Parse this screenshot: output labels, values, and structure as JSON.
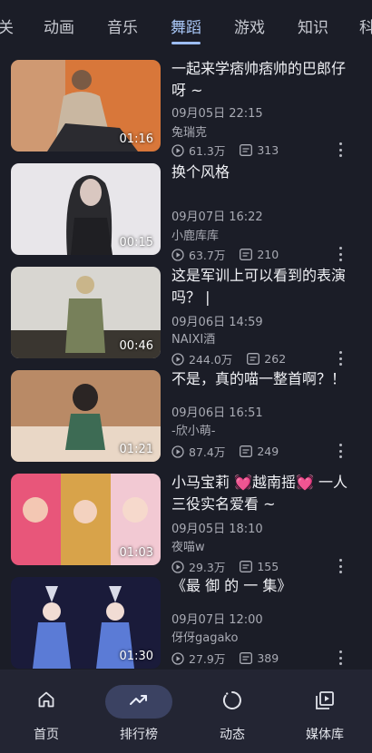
{
  "tabs": [
    {
      "label": "关",
      "active": false
    },
    {
      "label": "动画",
      "active": false
    },
    {
      "label": "音乐",
      "active": false
    },
    {
      "label": "舞蹈",
      "active": true
    },
    {
      "label": "游戏",
      "active": false
    },
    {
      "label": "知识",
      "active": false
    },
    {
      "label": "科",
      "active": false
    }
  ],
  "videos": [
    {
      "title": "一起来学痞帅痞帅的巴郎仔呀 ~",
      "date": "09月05日 22:15",
      "author": "兔瑞克",
      "views": "61.3万",
      "danmaku": "313",
      "duration": "01:16",
      "thumb_colors": [
        "#d8773a",
        "#c9b7a1",
        "#7a5a44"
      ]
    },
    {
      "title": "换个风格",
      "date": "09月07日 16:22",
      "author": "小鹿库库",
      "views": "63.7万",
      "danmaku": "210",
      "duration": "00:15",
      "thumb_colors": [
        "#e8e6ea",
        "#2a2a2e",
        "#d9c7c0"
      ]
    },
    {
      "title": "这是军训上可以看到的表演吗？ |",
      "date": "09月06日 14:59",
      "author": "NAIXI酒",
      "views": "244.0万",
      "danmaku": "262",
      "duration": "00:46",
      "thumb_colors": [
        "#d8d6d1",
        "#77805a",
        "#3a3630"
      ]
    },
    {
      "title": "不是，真的喵一整首啊？！",
      "date": "09月06日 16:51",
      "author": "-欣小萌-",
      "views": "87.4万",
      "danmaku": "249",
      "duration": "01:21",
      "thumb_colors": [
        "#b98a66",
        "#e9d7c6",
        "#3d6b54"
      ]
    },
    {
      "title": "小马宝莉 💓越南摇💓 一人三役实名爱看 ~",
      "date": "09月05日 18:10",
      "author": "夜喵w",
      "views": "29.3万",
      "danmaku": "155",
      "duration": "01:03",
      "thumb_colors": [
        "#e8567a",
        "#d8a34a",
        "#f2c9d3"
      ]
    },
    {
      "title": "《最 御 的 一 集》",
      "date": "09月07日 12:00",
      "author": "伢伢gagako",
      "views": "27.9万",
      "danmaku": "389",
      "duration": "01:30",
      "thumb_colors": [
        "#1a1b3a",
        "#5b7bd6",
        "#d9dbe8"
      ]
    }
  ],
  "bottom_nav": [
    {
      "label": "首页",
      "icon": "home-icon",
      "active": false
    },
    {
      "label": "排行榜",
      "icon": "trending-icon",
      "active": true
    },
    {
      "label": "动态",
      "icon": "activity-icon",
      "active": false
    },
    {
      "label": "媒体库",
      "icon": "library-icon",
      "active": false
    }
  ],
  "colors": {
    "background": "#1b1d27",
    "accent": "#a9c7f7",
    "nav_background": "#232533",
    "active_pill": "#3b4262"
  }
}
